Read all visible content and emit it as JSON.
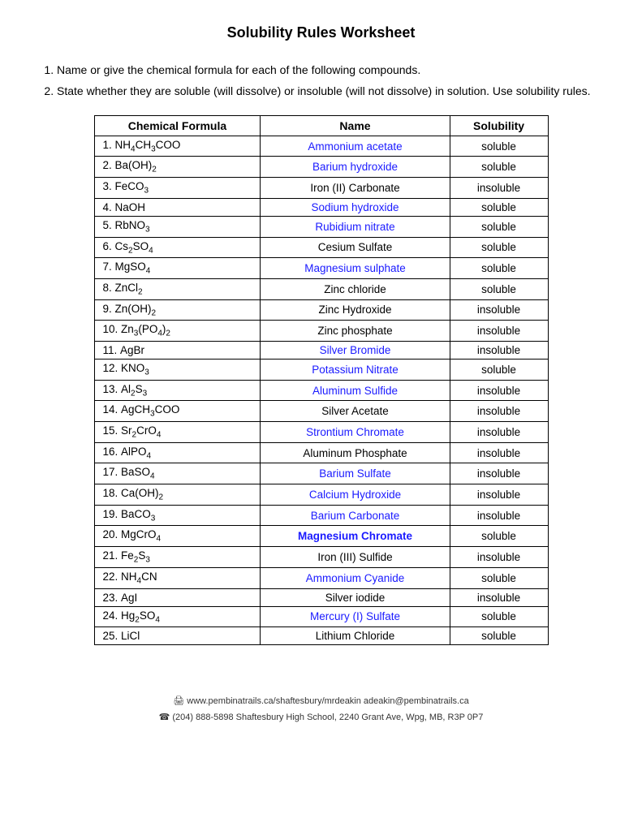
{
  "title": "Solubility Rules Worksheet",
  "instructions": [
    "Name or give the chemical formula for each of the following compounds.",
    "State whether they are soluble (will dissolve) or insoluble (will not dissolve) in solution.  Use solubility rules."
  ],
  "table": {
    "headers": [
      "Chemical Formula",
      "Name",
      "Solubility"
    ],
    "rows": [
      {
        "num": "1.",
        "formula_html": "NH<sub>4</sub>CH<sub>3</sub>COO",
        "name": "Ammonium acetate",
        "name_blue": true,
        "solubility": "soluble",
        "formula_blue": false
      },
      {
        "num": "2.",
        "formula_html": "Ba(OH)<sub>2</sub>",
        "name": "Barium hydroxide",
        "name_blue": true,
        "solubility": "soluble",
        "formula_blue": false
      },
      {
        "num": "3.",
        "formula_html": "FeCO<sub>3</sub>",
        "name": "Iron (II) Carbonate",
        "name_blue": false,
        "solubility": "insoluble",
        "formula_blue": false
      },
      {
        "num": "4.",
        "formula_html": "NaOH",
        "name": "Sodium hydroxide",
        "name_blue": true,
        "solubility": "soluble",
        "formula_blue": false
      },
      {
        "num": "5.",
        "formula_html": "RbNO<sub>3</sub>",
        "name": "Rubidium nitrate",
        "name_blue": true,
        "solubility": "soluble",
        "formula_blue": false
      },
      {
        "num": "6.",
        "formula_html": "Cs<sub>2</sub>SO<sub>4</sub>",
        "name": "Cesium Sulfate",
        "name_blue": false,
        "solubility": "soluble",
        "formula_blue": false
      },
      {
        "num": "7.",
        "formula_html": "MgSO<sub>4</sub>",
        "name": "Magnesium sulphate",
        "name_blue": true,
        "solubility": "soluble",
        "formula_blue": false
      },
      {
        "num": "8.",
        "formula_html": "ZnCl<sub>2</sub>",
        "name": "Zinc chloride",
        "name_blue": false,
        "solubility": "soluble",
        "formula_blue": false
      },
      {
        "num": "9.",
        "formula_html": "Zn(OH)<sub>2</sub>",
        "name": "Zinc Hydroxide",
        "name_blue": false,
        "solubility": "insoluble",
        "formula_blue": false
      },
      {
        "num": "10.",
        "formula_html": "Zn<sub>3</sub>(PO<sub>4</sub>)<sub>2</sub>",
        "name": "Zinc phosphate",
        "name_blue": false,
        "solubility": "insoluble",
        "formula_blue": false
      },
      {
        "num": "11.",
        "formula_html": "AgBr",
        "name": "Silver Bromide",
        "name_blue": true,
        "solubility": "insoluble",
        "formula_blue": false
      },
      {
        "num": "12.",
        "formula_html": "KNO<sub>3</sub>",
        "name": "Potassium Nitrate",
        "name_blue": true,
        "solubility": "soluble",
        "formula_blue": false
      },
      {
        "num": "13.",
        "formula_html": "Al<sub>2</sub>S<sub>3</sub>",
        "name": "Aluminum Sulfide",
        "name_blue": true,
        "solubility": "insoluble",
        "formula_blue": false
      },
      {
        "num": "14.",
        "formula_html": "AgCH<sub>3</sub>COO",
        "name": "Silver Acetate",
        "name_blue": false,
        "solubility": "insoluble",
        "formula_blue": false
      },
      {
        "num": "15.",
        "formula_html": "Sr<sub>2</sub>CrO<sub>4</sub>",
        "name": "Strontium Chromate",
        "name_blue": true,
        "solubility": "insoluble",
        "formula_blue": false
      },
      {
        "num": "16.",
        "formula_html": "AlPO<sub>4</sub>",
        "name": "Aluminum Phosphate",
        "name_blue": false,
        "solubility": "insoluble",
        "formula_blue": false
      },
      {
        "num": "17.",
        "formula_html": "BaSO<sub>4</sub>",
        "name": "Barium Sulfate",
        "name_blue": true,
        "solubility": "insoluble",
        "formula_blue": false
      },
      {
        "num": "18.",
        "formula_html": "Ca(OH)<sub>2</sub>",
        "name": "Calcium Hydroxide",
        "name_blue": true,
        "solubility": "insoluble",
        "formula_blue": false
      },
      {
        "num": "19.",
        "formula_html": "BaCO<sub>3</sub>",
        "name": "Barium Carbonate",
        "name_blue": true,
        "solubility": "insoluble",
        "formula_blue": false
      },
      {
        "num": "20.",
        "formula_html": "MgCrO<sub>4</sub>",
        "name": "Magnesium Chromate",
        "name_blue": true,
        "name_bold": true,
        "solubility": "soluble",
        "formula_blue": false
      },
      {
        "num": "21.",
        "formula_html": "Fe<sub>2</sub>S<sub>3</sub>",
        "name": "Iron (III) Sulfide",
        "name_blue": false,
        "solubility": "insoluble",
        "formula_blue": false
      },
      {
        "num": "22.",
        "formula_html": "NH<sub>4</sub>CN",
        "name": "Ammonium Cyanide",
        "name_blue": true,
        "solubility": "soluble",
        "formula_blue": false
      },
      {
        "num": "23.",
        "formula_html": "AgI",
        "name": "Silver iodide",
        "name_blue": false,
        "solubility": "insoluble",
        "formula_blue": false
      },
      {
        "num": "24.",
        "formula_html": "Hg<sub>2</sub>SO<sub>4</sub>",
        "name": "Mercury (I) Sulfate",
        "name_blue": true,
        "solubility": "soluble",
        "formula_blue": false
      },
      {
        "num": "25.",
        "formula_html": "LiCl",
        "name": "Lithium Chloride",
        "name_blue": false,
        "solubility": "soluble",
        "formula_blue": false
      }
    ]
  },
  "footer": {
    "line1": "www.pembinatrails.ca/shaftesbury/mrdeakin  adeakin@pembinatrails.ca",
    "line2": "(204) 888-5898   Shaftesbury High School, 2240 Grant Ave, Wpg, MB, R3P 0P7"
  }
}
